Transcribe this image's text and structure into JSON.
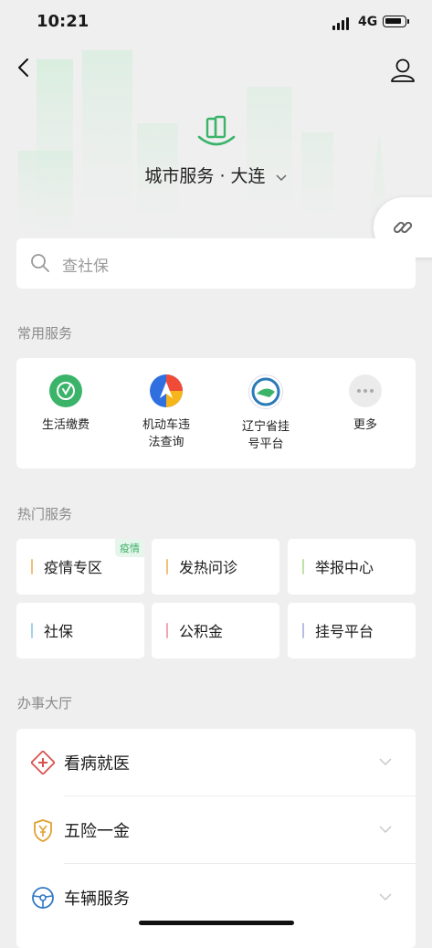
{
  "status_bar": {
    "time": "10:21",
    "network": "4G"
  },
  "header": {
    "city_title": "城市服务 · 大连"
  },
  "search": {
    "placeholder": "查社保"
  },
  "common_services": {
    "title": "常用服务",
    "items": [
      {
        "label": "生活缴费",
        "icon": "life-payment-icon",
        "color": "#3bb46a"
      },
      {
        "label": "机动车违\n法查询",
        "icon": "vehicle-violation-icon",
        "color": "#2f6fe0"
      },
      {
        "label": "辽宁省挂\n号平台",
        "icon": "liaoning-registration-icon",
        "color": "#2a7ab8"
      },
      {
        "label": "更多",
        "icon": "more-icon",
        "color": "#e8e8e8"
      }
    ]
  },
  "hot_services": {
    "title": "热门服务",
    "items": [
      {
        "label": "疫情专区",
        "tag": "疫情",
        "accent": "#f2c07a"
      },
      {
        "label": "发热问诊",
        "tag": "",
        "accent": "#f2c07a"
      },
      {
        "label": "举报中心",
        "tag": "",
        "accent": "#bfe3a4"
      },
      {
        "label": "社保",
        "tag": "",
        "accent": "#a9d2ec"
      },
      {
        "label": "公积金",
        "tag": "",
        "accent": "#f1a7ae"
      },
      {
        "label": "挂号平台",
        "tag": "",
        "accent": "#b7bde6"
      }
    ]
  },
  "service_hall": {
    "title": "办事大厅",
    "items": [
      {
        "label": "看病就医",
        "icon": "medical-cross-icon",
        "color": "#d9534f"
      },
      {
        "label": "五险一金",
        "icon": "yuan-shield-icon",
        "color": "#e0a030"
      },
      {
        "label": "车辆服务",
        "icon": "steering-wheel-icon",
        "color": "#2f78c4"
      }
    ]
  },
  "colors": {
    "brand_green": "#3bb46a",
    "background": "#efefef"
  }
}
